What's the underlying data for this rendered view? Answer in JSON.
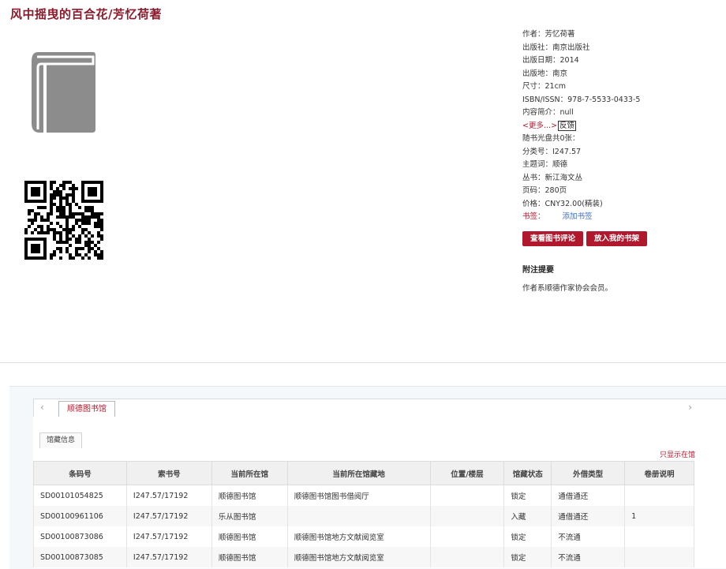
{
  "book": {
    "title": "风中摇曳的百合花/芳忆荷著"
  },
  "info": {
    "author": "作者：芳忆荷著",
    "publisher": "出版社：南京出版社",
    "pub_date": "出版日期：2014",
    "pub_place": "出版地：南京",
    "size": "尺寸：21cm",
    "isbn": "ISBN/ISSN：978-7-5533-0433-5",
    "summary": "内容简介：null",
    "more_link": "<更多...>",
    "feedback": "反馈",
    "cd": "随书光盘共0张：",
    "class_no": "分类号：I247.57",
    "subject": "主题词：顺德",
    "series": "丛书：新江海文丛",
    "pages": "页码：280页",
    "price": "价格：CNY32.00(精装)",
    "bookmark_label": "书签：",
    "add_bookmark": "添加书签"
  },
  "buttons": {
    "review": "查看图书评论",
    "shelf": "放入我的书架"
  },
  "notes": {
    "title": "附注提要",
    "text": "作者系顺德作家协会会员。"
  },
  "holdings": {
    "library_tab": "顺德图书馆",
    "sub_tab": "馆藏信息",
    "show_all": "只显示在馆",
    "columns": [
      "条码号",
      "索书号",
      "当前所在馆",
      "当前所在馆藏地",
      "位置/楼层",
      "馆藏状态",
      "外借类型",
      "卷册说明"
    ],
    "rows": [
      [
        "SD00101054825",
        "I247.57/17192",
        "顺德图书馆",
        "顺德图书馆图书借阅厅",
        "",
        "锁定",
        "通借通还",
        ""
      ],
      [
        "SD00100961106",
        "I247.57/17192",
        "乐从图书馆",
        "",
        "",
        "入藏",
        "通借通还",
        "1"
      ],
      [
        "SD00100873086",
        "I247.57/17192",
        "顺德图书馆",
        "顺德图书馆地方文献阅览室",
        "",
        "锁定",
        "不流通",
        ""
      ],
      [
        "SD00100873085",
        "I247.57/17192",
        "顺德图书馆",
        "顺德图书馆地方文献阅览室",
        "",
        "锁定",
        "不流通",
        ""
      ]
    ]
  },
  "colors": {
    "accent": "#b0182e",
    "title": "#8b1a2b",
    "link": "#3a6fc4"
  },
  "icons": {
    "cover": "book-icon",
    "qr": "qr-code-icon"
  }
}
